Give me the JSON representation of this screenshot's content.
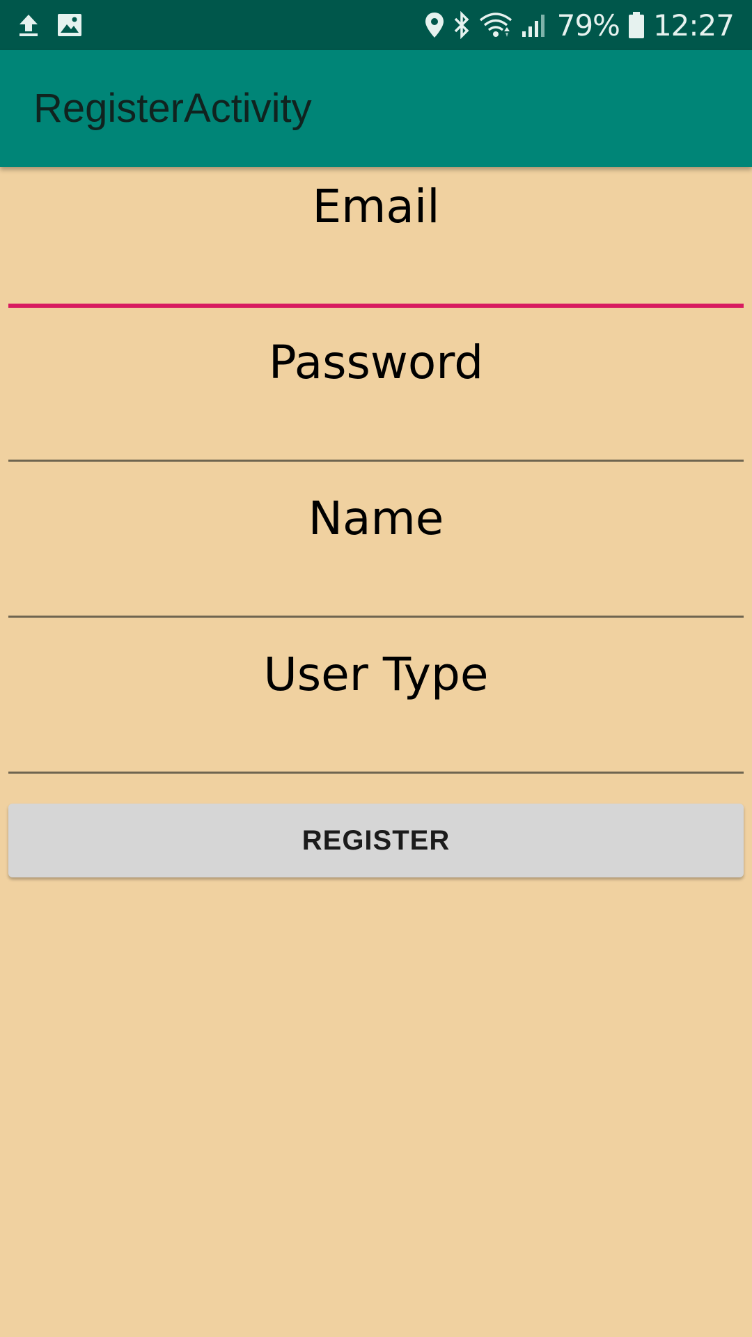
{
  "status_bar": {
    "left_icons": [
      "upload-icon",
      "image-icon"
    ],
    "right_icons": [
      "location-icon",
      "bluetooth-icon",
      "wifi-icon",
      "signal-icon"
    ],
    "battery_percent": "79%",
    "battery_icon": "battery-icon",
    "time": "12:27"
  },
  "app_bar": {
    "title": "RegisterActivity"
  },
  "form": {
    "fields": [
      {
        "label": "Email",
        "focused": true
      },
      {
        "label": "Password",
        "focused": false
      },
      {
        "label": "Name",
        "focused": false
      },
      {
        "label": "User Type",
        "focused": false
      }
    ]
  },
  "register_button": {
    "label": "REGISTER"
  },
  "colors": {
    "status_bar": "#00574B",
    "app_bar": "#008577",
    "background": "#F0D1A0",
    "focus_accent": "#D81B60",
    "button": "#D6D6D6"
  }
}
